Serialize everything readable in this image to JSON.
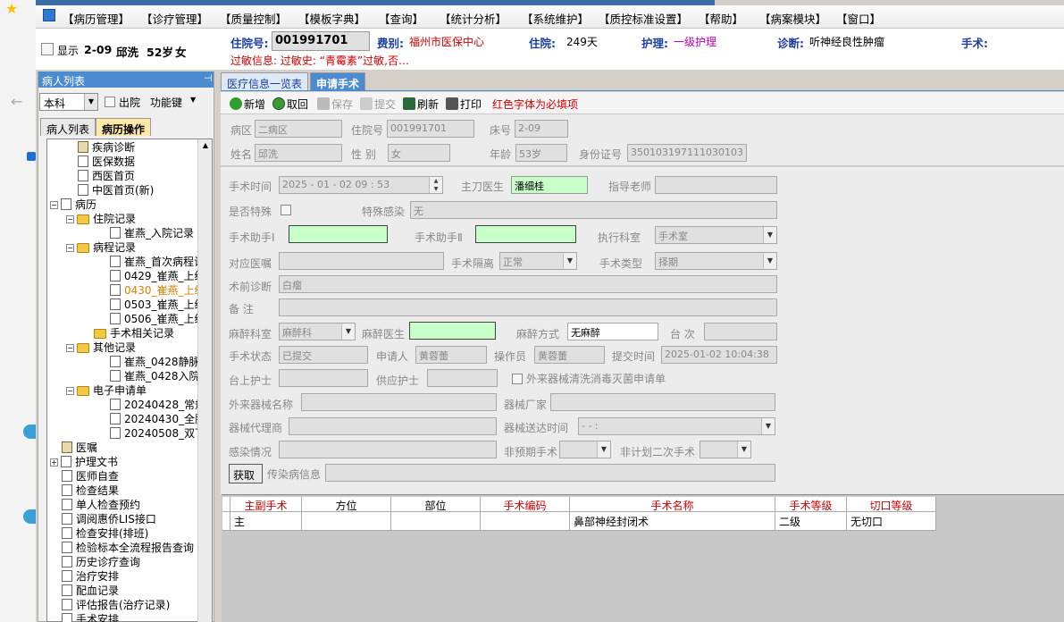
{
  "menubar": {
    "items": [
      "【病历管理】",
      "【诊疗管理】",
      "【质量控制】",
      "【模板字典】",
      "【查询】",
      "【统计分析】",
      "【系统维护】",
      "【质控标准设置】",
      "【帮助】",
      "【病案模块】",
      "【窗口】"
    ]
  },
  "patient_header": {
    "show_label": "显示",
    "bed": "2-09",
    "name": "邱洗",
    "age": "52岁",
    "sex": "女",
    "admission_no_label": "住院号:",
    "admission_no": "001991701",
    "category_label": "费别:",
    "category": "福州市医保中心",
    "stay_label": "住院:",
    "stay": "249天",
    "nursing_label": "护理:",
    "nursing": "一级护理",
    "diagnosis_label": "诊断:",
    "diagnosis": "听神经良性肿瘤",
    "surgery_label": "手术:",
    "allergy_text": "过敏信息: 过敏史: “青霉素”过敏,否…"
  },
  "left_panel": {
    "title": "病人列表",
    "pin": "ᵖ",
    "dept": "本科",
    "discharged_label": "出院",
    "function_key_label": "功能键",
    "tabs": [
      "病人列表",
      "病历操作"
    ],
    "tree": [
      {
        "label": "疾病诊断",
        "depth": 1,
        "icon": "book"
      },
      {
        "label": "医保数据",
        "depth": 1,
        "icon": "doc"
      },
      {
        "label": "西医首页",
        "depth": 1,
        "icon": "doc"
      },
      {
        "label": "中医首页(新)",
        "depth": 1,
        "icon": "doc"
      },
      {
        "label": "病历",
        "depth": 0,
        "icon": "doc",
        "expander": "−"
      },
      {
        "label": "住院记录",
        "depth": 1,
        "icon": "folder",
        "expander": "−"
      },
      {
        "label": "崔燕_入院记录",
        "depth": 3,
        "icon": "doc"
      },
      {
        "label": "病程记录",
        "depth": 1,
        "icon": "folder",
        "expander": "−"
      },
      {
        "label": "崔燕_首次病程记录",
        "depth": 3,
        "icon": "doc"
      },
      {
        "label": "0429_崔燕_上级医",
        "depth": 3,
        "icon": "doc"
      },
      {
        "label": "0430_崔燕_上级医",
        "depth": 3,
        "icon": "doc",
        "orange": true
      },
      {
        "label": "0503_崔燕_上级医",
        "depth": 3,
        "icon": "doc"
      },
      {
        "label": "0506_崔燕_上级医",
        "depth": 3,
        "icon": "doc"
      },
      {
        "label": "手术相关记录",
        "depth": 2,
        "icon": "folder"
      },
      {
        "label": "其他记录",
        "depth": 1,
        "icon": "folder",
        "expander": "−"
      },
      {
        "label": "崔燕_0428静脉血栓",
        "depth": 3,
        "icon": "doc"
      },
      {
        "label": "崔燕_0428入院患者",
        "depth": 3,
        "icon": "doc"
      },
      {
        "label": "电子申请单",
        "depth": 1,
        "icon": "folder",
        "expander": "−"
      },
      {
        "label": "20240428_常规心电",
        "depth": 3,
        "icon": "doc"
      },
      {
        "label": "20240430_全腹彩超",
        "depth": 3,
        "icon": "doc"
      },
      {
        "label": "20240508_双下肢静",
        "depth": 3,
        "icon": "doc"
      },
      {
        "label": "医嘱",
        "depth": 0,
        "icon": "book"
      },
      {
        "label": "护理文书",
        "depth": 0,
        "icon": "doc",
        "expander": "+"
      },
      {
        "label": "医师自查",
        "depth": 0,
        "icon": "doc"
      },
      {
        "label": "检查结果",
        "depth": 0,
        "icon": "doc"
      },
      {
        "label": "单人检查预约",
        "depth": 0,
        "icon": "doc"
      },
      {
        "label": "调阅惠侨LIS接口",
        "depth": 0,
        "icon": "doc"
      },
      {
        "label": "检查安排(排班)",
        "depth": 0,
        "icon": "doc"
      },
      {
        "label": "检验标本全流程报告查询",
        "depth": 0,
        "icon": "doc"
      },
      {
        "label": "历史诊疗查询",
        "depth": 0,
        "icon": "doc"
      },
      {
        "label": "治疗安排",
        "depth": 0,
        "icon": "doc"
      },
      {
        "label": "配血记录",
        "depth": 0,
        "icon": "doc"
      },
      {
        "label": "评估报告(治疗记录)",
        "depth": 0,
        "icon": "doc"
      },
      {
        "label": "手术安排",
        "depth": 0,
        "icon": "doc"
      }
    ]
  },
  "right_panel": {
    "tabs": [
      "医疗信息一览表",
      "申请手术"
    ],
    "toolbar": {
      "new": "新增",
      "cancel": "取回",
      "save": "保存",
      "submit": "提交",
      "refresh": "刷新",
      "print": "打印",
      "hint": "红色字体为必填项"
    },
    "basic": {
      "ward_label": "病区",
      "ward": "二病区",
      "admno_label": "住院号",
      "admno": "001991701",
      "bed_label": "床号",
      "bed": "2-09",
      "name_label": "姓名",
      "name": "邱洗",
      "sex_label": "性  别",
      "sex": "女",
      "age_label": "年龄",
      "age": "53岁",
      "id_label": "身份证号",
      "id": "350103197111030103"
    },
    "form": {
      "op_time_label": "手术时间",
      "op_time": "2025 - 01 - 02    09 : 53",
      "surgeon_label": "主刀医生",
      "surgeon": "潘细桂",
      "mentor_label": "指导老师",
      "mentor": "",
      "special_label": "是否特殊",
      "special_infection_label": "特殊感染",
      "special_infection": "无",
      "asst1_label": "手术助手Ⅰ",
      "asst1": "",
      "asst2_label": "手术助手Ⅱ",
      "asst2": "",
      "exec_dept_label": "执行科室",
      "exec_dept": "手术室",
      "order_label": "对应医嘱",
      "order": "",
      "isolation_label": "手术隔离",
      "isolation": "正常",
      "op_type_label": "手术类型",
      "op_type": "择期",
      "preop_diag_label": "术前诊断",
      "preop_diag": "白瘤",
      "remark_label": "备    注",
      "remark": "",
      "anes_dept_label": "麻醉科室",
      "anes_dept": "麻醉科",
      "anes_doctor_label": "麻醉医生",
      "anes_doctor": "",
      "anes_method_label": "麻醉方式",
      "anes_method": "无麻醉",
      "table_no_label": "台 次",
      "table_no": "",
      "status_label": "手术状态",
      "status": "已提交",
      "applicant_label": "申请人",
      "applicant": "黄蓉蕾",
      "operator_label": "操作员",
      "operator": "黄蓉蕾",
      "submit_time_label": "提交时间",
      "submit_time": "2025-01-02 10:04:38",
      "scrub_nurse_label": "台上护士",
      "scrub_nurse": "",
      "circ_nurse_label": "供应护士",
      "circ_nurse": "",
      "external_label": "外来器械清洗消毒灭菌申请单",
      "ext_name_label": "外来器械名称",
      "ext_name": "",
      "maker_label": "器械厂家",
      "maker": "",
      "agent_label": "器械代理商",
      "agent": "",
      "delivery_label": "器械送达时间",
      "delivery": "  -   -          :",
      "infection_label": "感染情况",
      "infection": "",
      "unplanned_label": "非预期手术",
      "unplanned": "",
      "second_label": "非计划二次手术",
      "second": "",
      "get_button": "获取",
      "infect_info_label": "传染病信息",
      "infect_info": ""
    },
    "grid": {
      "headers": [
        "主副手术",
        "方位",
        "部位",
        "手术编码",
        "手术名称",
        "手术等级",
        "切口等级"
      ],
      "rows": [
        [
          "主",
          "",
          "",
          "",
          "鼻部神经封闭术",
          "二级",
          "无切口"
        ]
      ]
    }
  }
}
